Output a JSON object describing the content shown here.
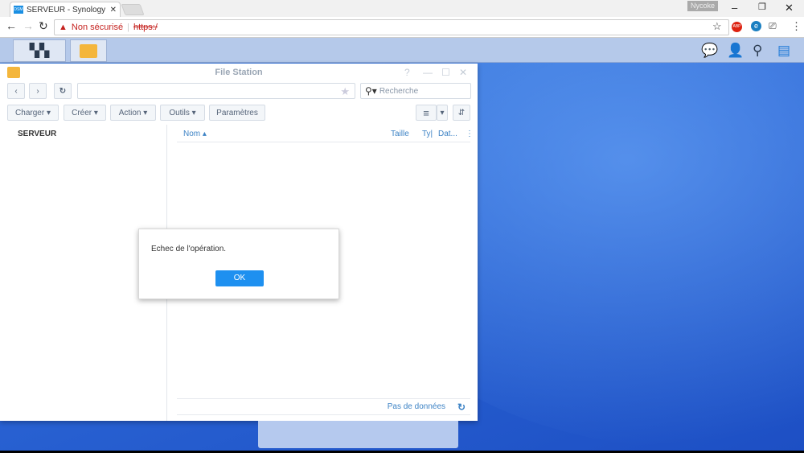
{
  "browser": {
    "tab_title": "SERVEUR - Synology Disk",
    "favicon_text": "DSM",
    "user": "Nycoke",
    "security_label": "Non sécurisé",
    "url": "https:/",
    "extensions": [
      "adblock-icon",
      "extension-e-icon",
      "cast-icon",
      "menu-icon"
    ]
  },
  "taskbar": {
    "apps": [
      "main-menu",
      "file-station"
    ],
    "right_icons": [
      "notifications-icon",
      "user-icon",
      "search-icon",
      "widgets-icon"
    ]
  },
  "file_station": {
    "title": "File Station",
    "search_placeholder": "Recherche",
    "toolbar": {
      "charger": "Charger ▾",
      "creer": "Créer ▾",
      "action": "Action ▾",
      "outils": "Outils ▾",
      "parametres": "Paramètres"
    },
    "sidebar": {
      "root": "SERVEUR"
    },
    "columns": {
      "nom": "Nom ▴",
      "taille": "Taille",
      "type": "Ty|",
      "date": "Dat..."
    },
    "status": "Pas de données"
  },
  "dialog": {
    "message": "Echec de l'opération.",
    "ok": "OK"
  },
  "colors": {
    "accent": "#1e90f0",
    "desktop": "#2a64d4",
    "taskbar": "#b5c9ea"
  }
}
